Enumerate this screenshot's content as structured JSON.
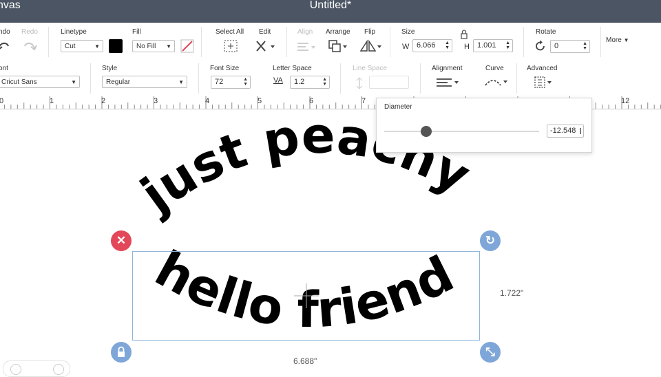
{
  "app": {
    "title": "nvas",
    "document_title": "Untitled*"
  },
  "toolbar1": {
    "undo_label": "ndo",
    "redo_label": "Redo",
    "linetype": {
      "label": "Linetype",
      "value": "Cut"
    },
    "fill": {
      "label": "Fill",
      "value": "No Fill"
    },
    "select_all_label": "Select All",
    "edit_label": "Edit",
    "align_label": "Align",
    "arrange_label": "Arrange",
    "flip_label": "Flip",
    "size": {
      "label": "Size",
      "w_label": "W",
      "w_value": "6.066",
      "h_label": "H",
      "h_value": "1.001"
    },
    "rotate": {
      "label": "Rotate",
      "value": "0"
    },
    "more_label": "More"
  },
  "toolbar2": {
    "font": {
      "label": "ont",
      "value": "Cricut Sans"
    },
    "style": {
      "label": "Style",
      "value": "Regular"
    },
    "font_size": {
      "label": "Font Size",
      "value": "72"
    },
    "letter_space": {
      "label": "Letter Space",
      "value": "1.2",
      "icon_text": "VA"
    },
    "line_space_label": "Line Space",
    "alignment_label": "Alignment",
    "curve_label": "Curve",
    "advanced_label": "Advanced"
  },
  "ruler": {
    "numbers": [
      "0",
      "1",
      "2",
      "3",
      "4",
      "5",
      "6",
      "7",
      "12"
    ]
  },
  "curve_panel": {
    "label": "Diameter",
    "value": "-12.548",
    "slider_fraction": 0.27
  },
  "canvas": {
    "text_top": "just peachy",
    "text_bottom": "hello friend",
    "width_label": "6.688\"",
    "height_label": "1.722\""
  },
  "colors": {
    "titlebar": "#4b5563",
    "delete_handle": "#e2475a",
    "handle_blue": "#7ea6d8",
    "selection": "#8fb5dc"
  }
}
